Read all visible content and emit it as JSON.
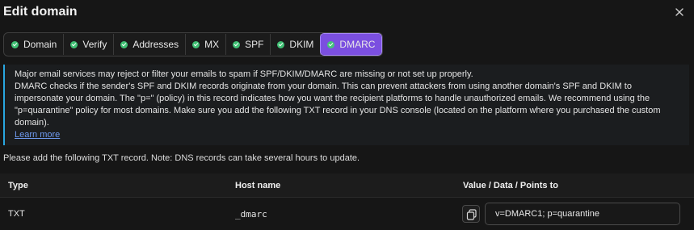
{
  "dialog": {
    "title": "Edit domain",
    "close_icon": "close-icon"
  },
  "tabs": [
    {
      "label": "Domain",
      "status": "complete"
    },
    {
      "label": "Verify",
      "status": "complete"
    },
    {
      "label": "Addresses",
      "status": "complete"
    },
    {
      "label": "MX",
      "status": "complete"
    },
    {
      "label": "SPF",
      "status": "complete"
    },
    {
      "label": "DKIM",
      "status": "complete"
    },
    {
      "label": "DMARC",
      "status": "complete",
      "active": true
    }
  ],
  "info": {
    "line1": "Major email services may reject or filter your emails to spam if SPF/DKIM/DMARC are missing or not set up properly.",
    "line2": "DMARC checks if the sender's SPF and DKIM records originate from your domain. This can prevent attackers from using another domain's SPF and DKIM to impersonate your domain. The \"p=\" (policy) in this record indicates how you want the recipient platforms to handle unauthorized emails. We recommend using the \"p=quarantine\" policy for most domains. Make sure you add the following TXT record in your DNS console (located on the platform where you purchased the custom domain).",
    "link": "Learn more"
  },
  "note": "Please add the following TXT record. Note: DNS records can take several hours to update.",
  "table": {
    "headers": [
      "Type",
      "Host name",
      "Value / Data / Points to"
    ],
    "rows": [
      {
        "type": "TXT",
        "host": "_dmarc",
        "value": "v=DMARC1; p=quarantine"
      }
    ]
  },
  "colors": {
    "accent": "#7b4fe0",
    "success": "#3fbf73",
    "info_border": "#29a6e0",
    "link": "#6f9bf0"
  }
}
